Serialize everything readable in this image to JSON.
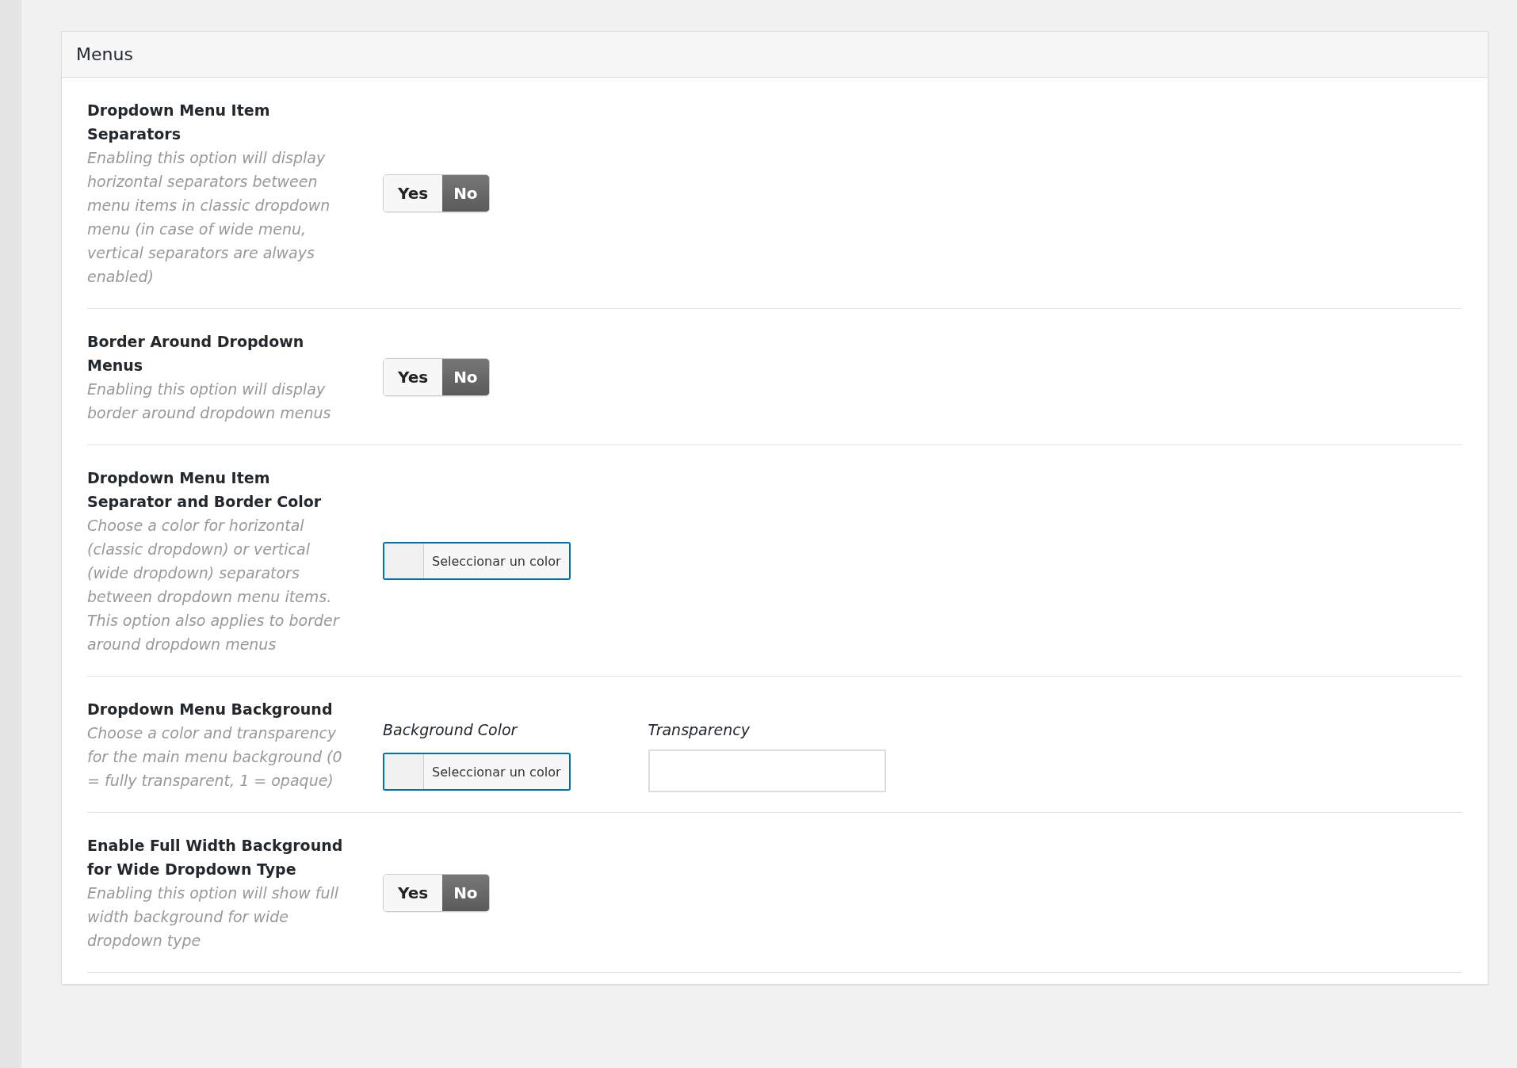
{
  "panel": {
    "title": "Menus"
  },
  "settings": [
    {
      "kind": "toggle",
      "title": "Dropdown Menu Item Separators",
      "description": "Enabling this option will display horizontal separators between menu items in classic dropdown menu (in case of wide menu, vertical separators are always enabled)",
      "options": [
        {
          "label": "Yes",
          "selected": false
        },
        {
          "label": "No",
          "selected": true
        }
      ]
    },
    {
      "kind": "toggle",
      "title": "Border Around Dropdown Menus",
      "description": "Enabling this option will display border around dropdown menus",
      "options": [
        {
          "label": "Yes",
          "selected": false
        },
        {
          "label": "No",
          "selected": true
        }
      ]
    },
    {
      "kind": "color",
      "title": "Dropdown Menu Item Separator and Border Color",
      "description": "Choose a color for horizontal (classic dropdown) or vertical (wide dropdown) separators between dropdown menu items. This option also applies to border around dropdown menus",
      "button": "Seleccionar un color"
    },
    {
      "kind": "color_transparency",
      "title": "Dropdown Menu Background",
      "description": "Choose a color and transparency for the main menu background (0 = fully transparent, 1 = opaque)",
      "color_label": "Background Color",
      "button": "Seleccionar un color",
      "transparency_label": "Transparency"
    },
    {
      "kind": "toggle",
      "title": "Enable Full Width Background for Wide Dropdown Type",
      "description": "Enabling this option will show full width background for wide dropdown type",
      "options": [
        {
          "label": "Yes",
          "selected": false
        },
        {
          "label": "No",
          "selected": true
        }
      ]
    }
  ]
}
